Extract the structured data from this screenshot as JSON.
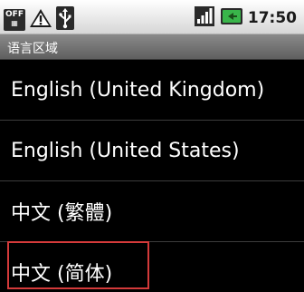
{
  "status_bar": {
    "usb_debug_icon_text": "OFF",
    "clock": "17:50",
    "icons": [
      "usb-debugging-icon",
      "warning-icon",
      "usb-icon",
      "signal-icon",
      "battery-icon"
    ]
  },
  "header": {
    "title": "语言区域"
  },
  "locales": [
    {
      "label": "English (United Kingdom)"
    },
    {
      "label": "English (United States)"
    },
    {
      "label": "中文 (繁體)"
    },
    {
      "label": "中文 (简体)"
    }
  ],
  "colors": {
    "highlight": "#d43a3a"
  }
}
